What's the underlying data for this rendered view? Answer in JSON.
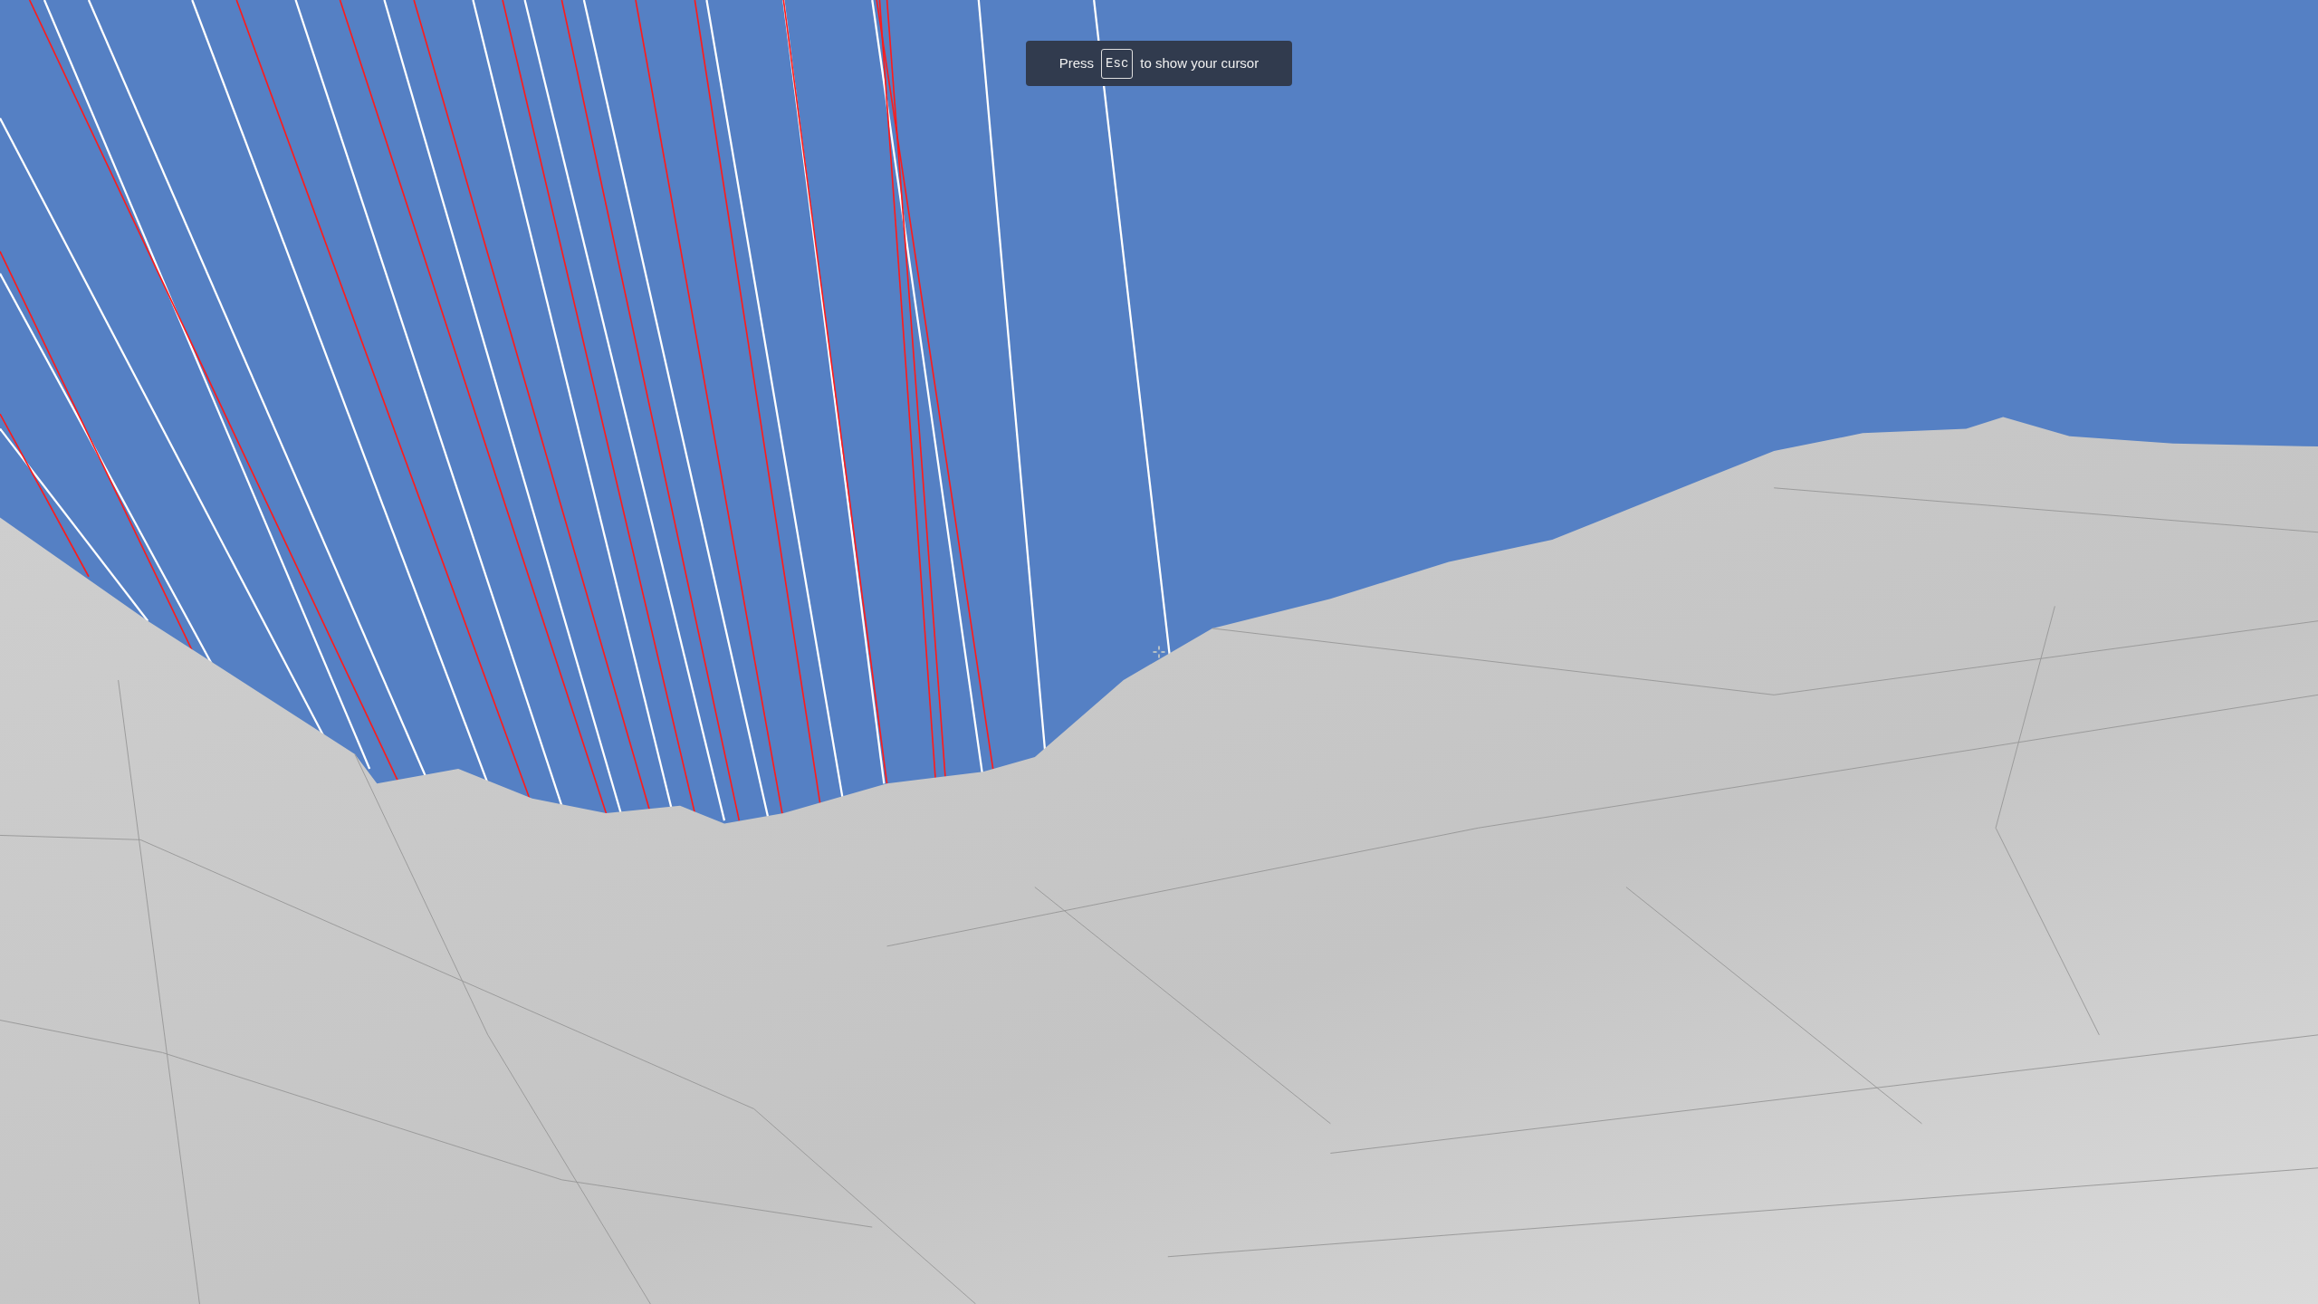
{
  "toast": {
    "before": "Press",
    "key": "Esc",
    "after": "to show your cursor"
  }
}
